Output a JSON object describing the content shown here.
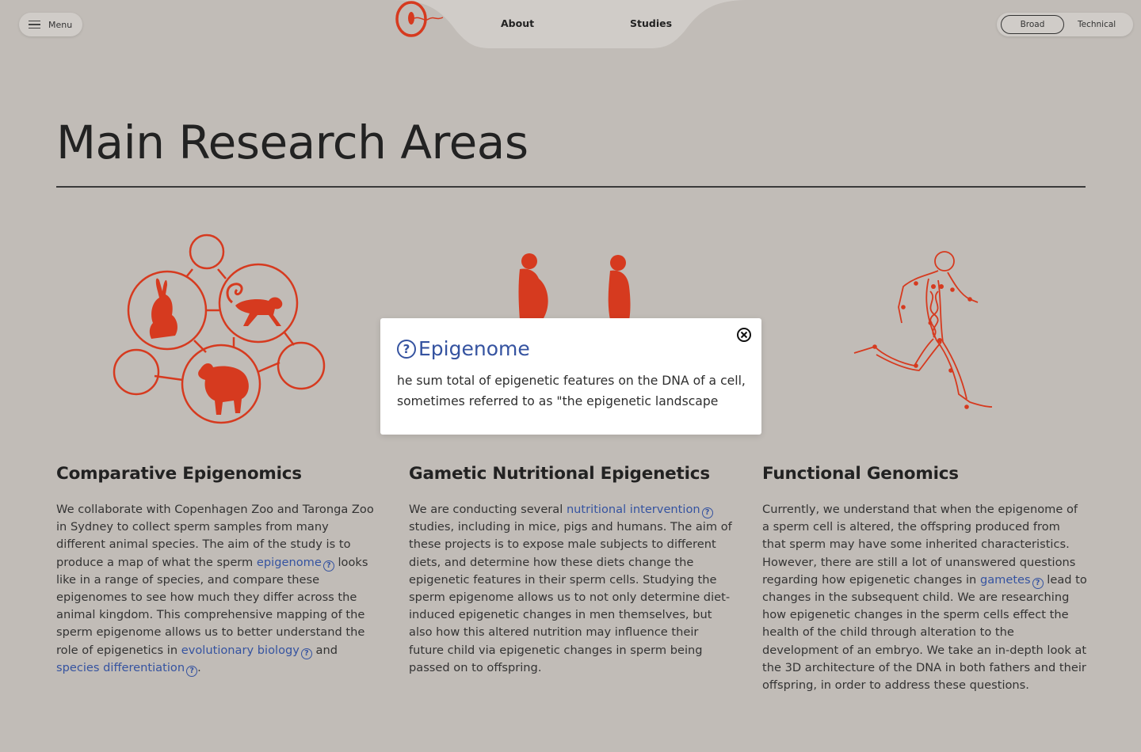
{
  "header": {
    "menu_label": "Menu",
    "nav_about": "About",
    "nav_studies": "Studies",
    "toggle_broad": "Broad",
    "toggle_technical": "Technical"
  },
  "page_title": "Main Research Areas",
  "columns": [
    {
      "title": "Comparative Epigenomics",
      "t1": "We collaborate with Copenhagen Zoo and Taronga Zoo in Sydney to collect sperm samples from many different animal species. The aim of the study is to produce a map of what the sperm ",
      "l1": "epigenome",
      "t2": " looks like in a range of species, and compare these epigenomes to see how much they differ across the animal kingdom. This comprehensive mapping of the sperm epigenome allows us to better understand the role of epigenetics in ",
      "l2": "evolutionary biology",
      "t3": " and ",
      "l3": "species differentiation",
      "t4": "."
    },
    {
      "title": "Gametic Nutritional Epigenetics",
      "t1": "We are conducting several ",
      "l1": "nutritional intervention",
      "t2": " studies, including in mice, pigs and humans. The aim of these projects is to expose male subjects to different diets, and determine how these diets change the epigenetic features in their sperm cells. Studying the sperm epigenome allows us to not only determine diet-induced epigenetic changes in men themselves, but also how this altered nutrition may influence their future child via epigenetic changes in sperm being passed on to offspring."
    },
    {
      "title": "Functional Genomics",
      "t1": "Currently, we understand that when the epigenome of a sperm cell is altered, the offspring produced from that sperm may have some inherited characteristics.  However, there are still a lot of unanswered questions regarding how epigenetic changes in ",
      "l1": "gametes",
      "t2": " lead to changes in the subsequent child.  We are researching how epigenetic changes in the sperm cells effect the health of the child through alteration to the development of an embryo. We take an in-depth look at the 3D architecture of the DNA in both fathers and their offspring, in order to address these questions."
    }
  ],
  "popup": {
    "title": "Epigenome",
    "body": "he sum total of epigenetic features on the DNA of a cell, sometimes referred to as \"the epigenetic landscape"
  },
  "icons": {
    "help": "?",
    "close": "⊗"
  },
  "colors": {
    "accent": "#d63a1f",
    "link": "#3553a0",
    "background": "#c1bcb7"
  }
}
